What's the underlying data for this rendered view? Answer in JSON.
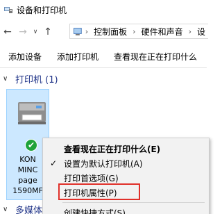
{
  "window": {
    "title": "设备和打印机"
  },
  "nav": {
    "back_icon": "arrow-left-icon",
    "forward_icon": "arrow-right-icon",
    "dropdown_icon": "chevron-down-icon",
    "up_icon": "arrow-up-icon",
    "breadcrumb": [
      "控制面板",
      "硬件和声音",
      "设"
    ]
  },
  "commands": [
    "添加设备",
    "添加打印机",
    "查看现在正在打印什么"
  ],
  "groups": {
    "printers": {
      "label": "打印机 (1)"
    },
    "multimedia": {
      "label": "多媒体"
    }
  },
  "printer": {
    "name_lines": "KON\nMINC\npage\n1590MF"
  },
  "context_menu": {
    "items": [
      {
        "label": "查看现在正在打印什么(E)",
        "bold": true,
        "checked": false
      },
      {
        "label": "设置为默认打印机(A)",
        "bold": false,
        "checked": true
      },
      {
        "label": "打印首选项(G)",
        "bold": false,
        "checked": false
      },
      {
        "label": "打印机属性(P)",
        "bold": false,
        "checked": false
      },
      {
        "label": "创建快捷方式(S)",
        "bold": false,
        "checked": false
      }
    ]
  },
  "colors": {
    "accent_link": "#1e3287",
    "selection": "#cce8ff",
    "highlight_box": "#e0302a",
    "default_check": "#1fa33a"
  }
}
